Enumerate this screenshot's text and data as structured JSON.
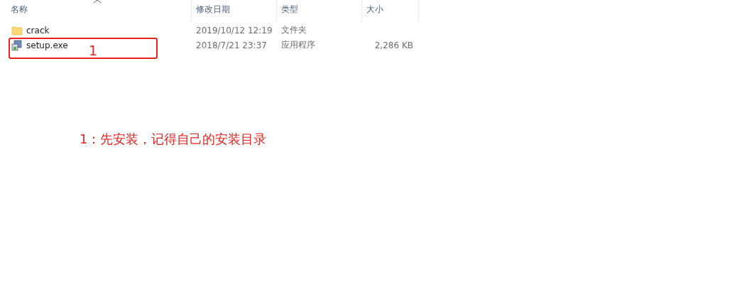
{
  "columns": [
    {
      "label": "名称"
    },
    {
      "label": "修改日期"
    },
    {
      "label": "类型"
    },
    {
      "label": "大小"
    }
  ],
  "files": [
    {
      "kind": "folder",
      "name": "crack",
      "modified": "2019/10/12 12:19",
      "type": "文件夹"
    },
    {
      "kind": "installer",
      "name": "setup.exe",
      "modified": "2018/7/21 23:37",
      "type": "应用程序",
      "size": "2,286 KB"
    }
  ],
  "annotation": {
    "number": "1",
    "note": "1：先安装，记得自己的安装目录"
  }
}
